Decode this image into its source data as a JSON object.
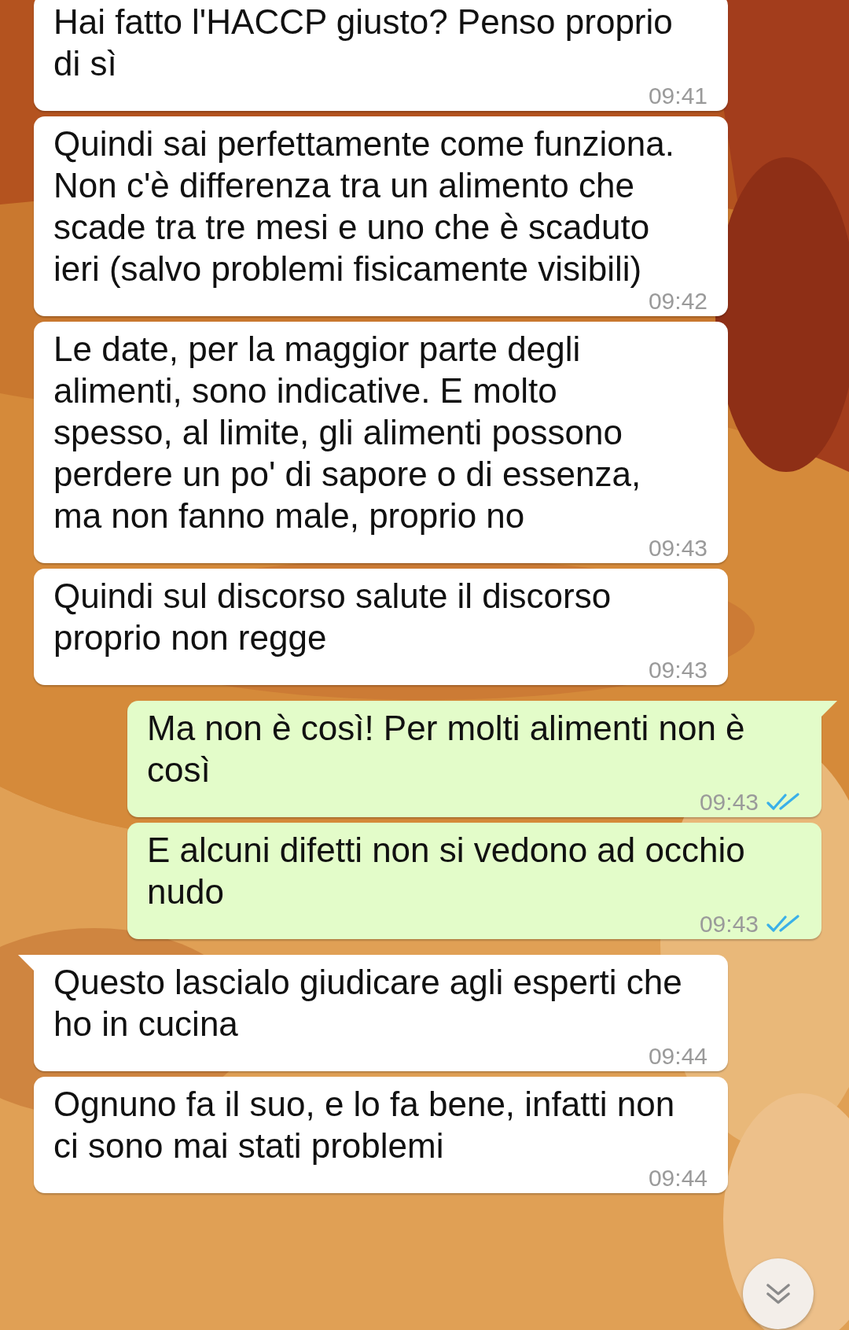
{
  "messages": [
    {
      "kind": "incoming",
      "tail": false,
      "text": "Hai fatto l'HACCP giusto? Penso proprio di sì",
      "time": "09:41"
    },
    {
      "kind": "incoming",
      "tail": false,
      "text": "Quindi sai perfettamente come funziona. Non c'è differenza tra un alimento che scade tra tre mesi e uno che è scaduto ieri (salvo problemi fisicamente visibili)",
      "time": "09:42"
    },
    {
      "kind": "incoming",
      "tail": false,
      "text": "Le date, per la maggior parte degli alimenti, sono indicative. E molto spesso, al limite, gli alimenti possono perdere un po' di sapore o di essenza, ma non fanno male, proprio no",
      "time": "09:43"
    },
    {
      "kind": "incoming",
      "tail": false,
      "text": "Quindi sul discorso salute il discorso proprio non regge",
      "time": "09:43"
    },
    {
      "kind": "outgoing",
      "tail": true,
      "text": "Ma non è così! Per molti alimenti non è così",
      "time": "09:43",
      "read": true
    },
    {
      "kind": "outgoing",
      "tail": false,
      "text": "E alcuni difetti non si vedono ad occhio nudo",
      "time": "09:43",
      "read": true
    },
    {
      "kind": "incoming",
      "tail": true,
      "text": "Questo lascialo giudicare agli esperti che ho in cucina",
      "time": "09:44"
    },
    {
      "kind": "incoming",
      "tail": false,
      "text": "Ognuno fa il suo, e lo fa bene, infatti non ci sono mai stati problemi",
      "time": "09:44"
    }
  ]
}
